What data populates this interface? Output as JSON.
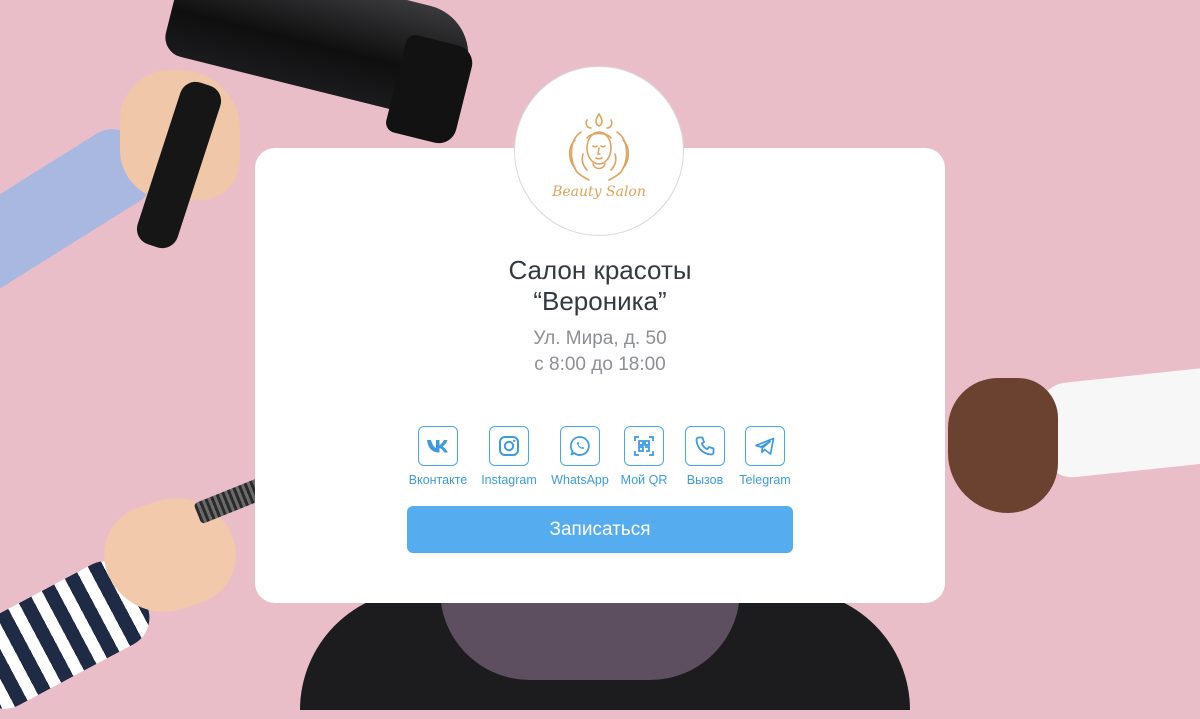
{
  "logo": {
    "text": "Beauty Salon",
    "icon": "woman-face-logo-icon",
    "color": "#e0a25d"
  },
  "salon": {
    "title_line1": "Салон красоты",
    "title_line2": "“Вероника”",
    "address": "Ул. Мира, д. 50",
    "hours": "с 8:00 до 18:00"
  },
  "socials": [
    {
      "label": "Вконтакте",
      "icon": "vk-icon"
    },
    {
      "label": "Instagram",
      "icon": "instagram-icon"
    },
    {
      "label": "WhatsApp",
      "icon": "whatsapp-icon"
    },
    {
      "label": "Мой QR",
      "icon": "qr-code-icon"
    },
    {
      "label": "Вызов",
      "icon": "phone-icon"
    },
    {
      "label": "Telegram",
      "icon": "telegram-icon"
    }
  ],
  "cta": {
    "label": "Записаться"
  },
  "colors": {
    "background": "#eabec8",
    "accent": "#55acef",
    "icon_stroke": "#4aa6e8"
  }
}
